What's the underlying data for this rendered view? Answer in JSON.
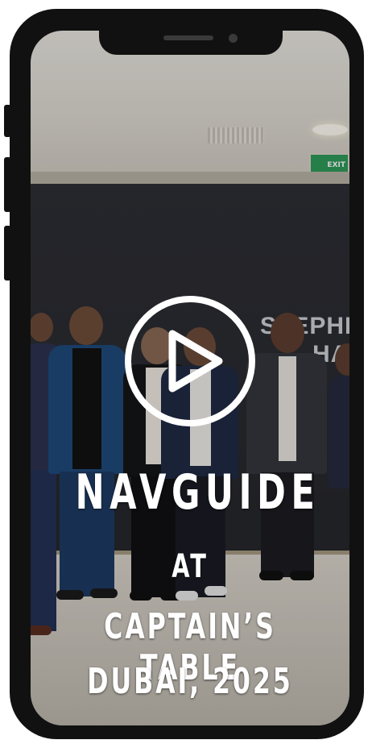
{
  "video": {
    "title": "NAVGUIDE",
    "connector": "AT",
    "event": "CAPTAIN’S TABLE",
    "location_year": "DUBAI, 2025",
    "play_icon": "play-icon"
  },
  "scene": {
    "wall_text_line1": "STEPHEN",
    "wall_text_line2": "HA",
    "exit_sign": "EXIT"
  },
  "colors": {
    "phone_frame": "#111111",
    "caption_text": "#ffffff",
    "wall": "#2a2b30",
    "exit_sign": "#2f9a5a"
  }
}
